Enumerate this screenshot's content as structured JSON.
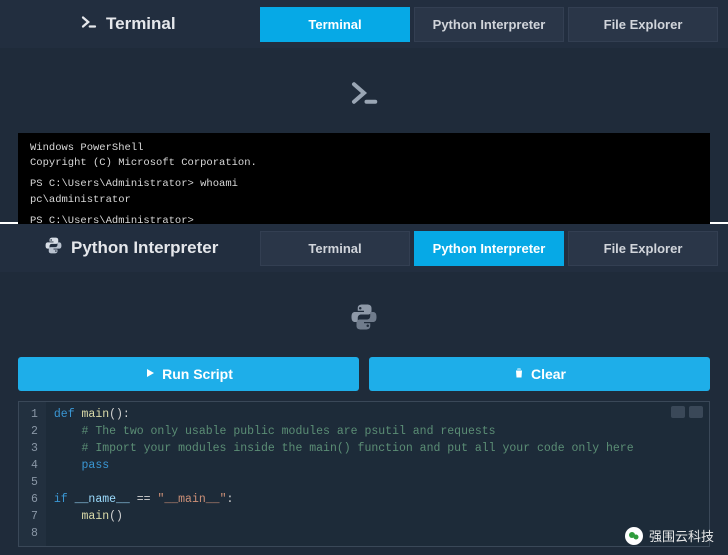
{
  "top": {
    "title": "Terminal",
    "tabs": [
      {
        "label": "Terminal",
        "active": true
      },
      {
        "label": "Python Interpreter",
        "active": false
      },
      {
        "label": "File Explorer",
        "active": false
      }
    ],
    "console": [
      "Windows PowerShell",
      "Copyright (C) Microsoft Corporation.",
      "",
      "PS C:\\Users\\Administrator> whoami",
      "pc\\administrator",
      "",
      "PS C:\\Users\\Administrator>"
    ]
  },
  "bottom": {
    "title": "Python Interpreter",
    "tabs": [
      {
        "label": "Terminal",
        "active": false
      },
      {
        "label": "Python Interpreter",
        "active": true
      },
      {
        "label": "File Explorer",
        "active": false
      }
    ],
    "buttons": {
      "run": "Run Script",
      "clear": "Clear"
    },
    "code": [
      {
        "n": 1,
        "tokens": [
          [
            "kw",
            "def "
          ],
          [
            "fn",
            "main"
          ],
          [
            "op",
            "():"
          ]
        ]
      },
      {
        "n": 2,
        "tokens": [
          [
            "op",
            "    "
          ],
          [
            "cm",
            "# The two only usable public modules are psutil and requests"
          ]
        ]
      },
      {
        "n": 3,
        "tokens": [
          [
            "op",
            "    "
          ],
          [
            "cm",
            "# Import your modules inside the main() function and put all your code only here"
          ]
        ]
      },
      {
        "n": 4,
        "tokens": [
          [
            "op",
            "    "
          ],
          [
            "kw",
            "pass"
          ]
        ]
      },
      {
        "n": 5,
        "tokens": []
      },
      {
        "n": 6,
        "tokens": [
          [
            "kw",
            "if "
          ],
          [
            "var",
            "__name__"
          ],
          [
            "op",
            " == "
          ],
          [
            "str",
            "\"__main__\""
          ],
          [
            "op",
            ":"
          ]
        ]
      },
      {
        "n": 7,
        "tokens": [
          [
            "op",
            "    "
          ],
          [
            "fn",
            "main"
          ],
          [
            "op",
            "()"
          ]
        ]
      },
      {
        "n": 8,
        "tokens": []
      }
    ]
  },
  "watermark": "强围云科技"
}
